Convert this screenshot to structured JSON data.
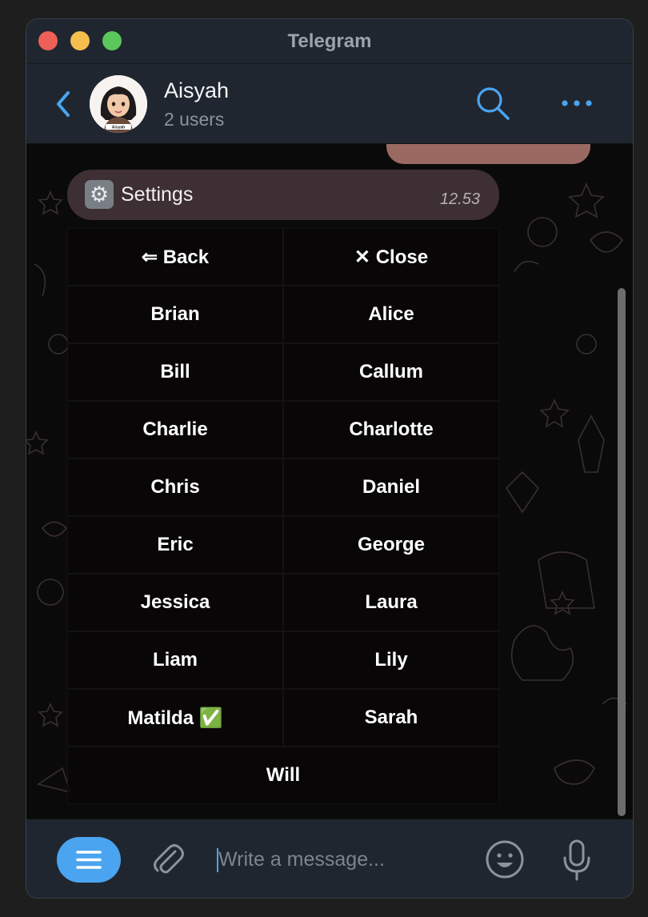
{
  "window": {
    "title": "Telegram"
  },
  "header": {
    "chat_name": "Aisyah",
    "subtitle": "2 users",
    "avatar_caption": "Aisyah"
  },
  "message": {
    "icon": "gear-emoji",
    "title": "Settings",
    "time": "12.53"
  },
  "keyboard": {
    "rows": [
      [
        "⇐ Back",
        "✕ Close"
      ],
      [
        "Brian",
        "Alice"
      ],
      [
        "Bill",
        "Callum"
      ],
      [
        "Charlie",
        "Charlotte"
      ],
      [
        "Chris",
        "Daniel"
      ],
      [
        "Eric",
        "George"
      ],
      [
        "Jessica",
        "Laura"
      ],
      [
        "Liam",
        "Lily"
      ],
      [
        "Matilda ✅",
        "Sarah"
      ],
      [
        "Will"
      ]
    ]
  },
  "composer": {
    "placeholder": "Write a message..."
  },
  "colors": {
    "accent": "#4aa4f0",
    "header_bg": "#20262f",
    "bubble_bg": "#3d2f33",
    "outgoing_bubble": "#9a6a62"
  }
}
